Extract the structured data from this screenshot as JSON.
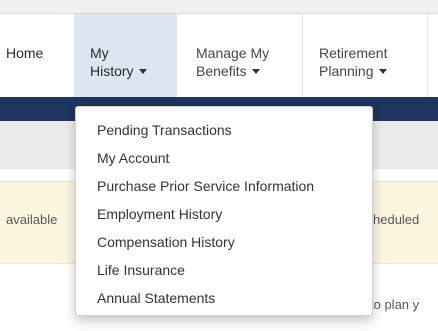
{
  "nav": {
    "home": "Home",
    "my_history_line1": "My",
    "my_history_line2": "History",
    "manage_line1": "Manage My",
    "manage_line2": "Benefits",
    "retirement_line1": "Retirement",
    "retirement_line2": "Planning"
  },
  "dropdown": {
    "items": [
      "Pending Transactions",
      "My Account",
      "Purchase Prior Service Information",
      "Employment History",
      "Compensation History",
      "Life Insurance",
      "Annual Statements"
    ]
  },
  "background": {
    "alert_left": "available",
    "alert_right": "heduled",
    "body_text": "to plan y"
  },
  "colors": {
    "header_bar": "#1e3560",
    "active_nav": "#dce6f2",
    "alert_bg": "#fcf6e1"
  }
}
